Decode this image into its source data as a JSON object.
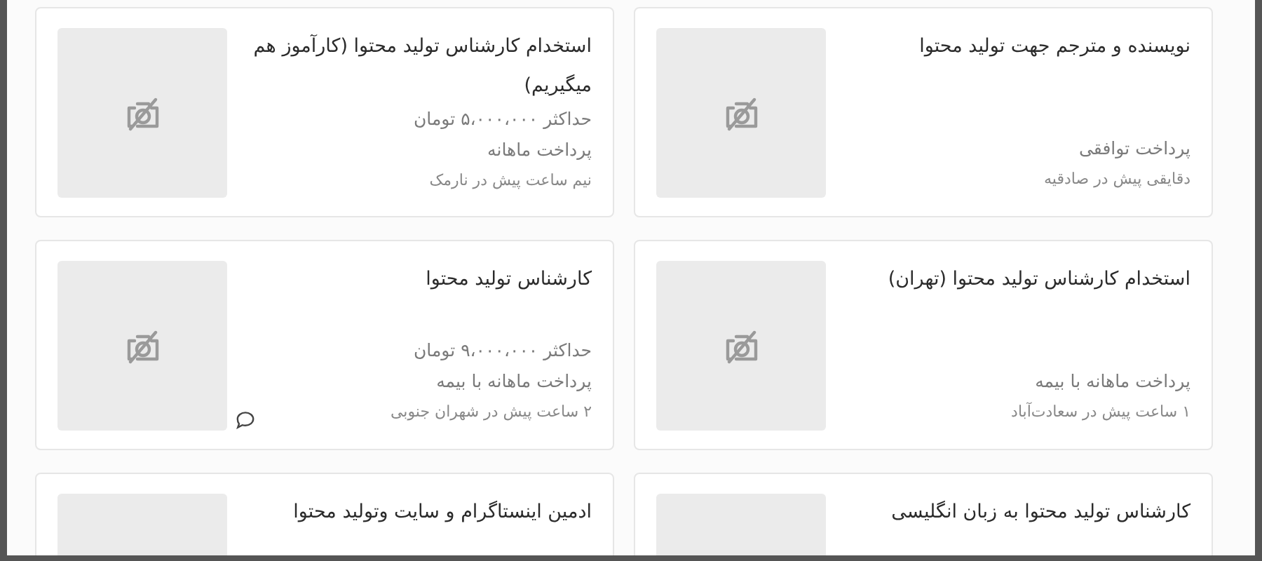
{
  "listings": [
    {
      "title": "نویسنده و مترجم جهت تولید محتوا",
      "payment": "پرداخت توافقی",
      "meta": "دقایقی پیش در صادقیه",
      "chat": false
    },
    {
      "title": "استخدام کارشناس تولید محتوا (کارآموز هم میگیریم)",
      "salary": "حداکثر ۵،۰۰۰،۰۰۰ تومان",
      "payment": "پرداخت ماهانه",
      "meta": "نیم ساعت پیش در نارمک",
      "chat": false
    },
    {
      "title": "استخدام کارشناس تولید محتوا (تهران)",
      "payment": "پرداخت ماهانه با بیمه",
      "meta": "۱ ساعت پیش در سعادت‌آباد",
      "chat": false
    },
    {
      "title": "کارشناس تولید محتوا",
      "salary": "حداکثر ۹،۰۰۰،۰۰۰ تومان",
      "payment": "پرداخت ماهانه با بیمه",
      "meta": "۲ ساعت پیش در شهران جنوبی",
      "chat": true
    },
    {
      "title": "کارشناس تولید محتوا به زبان انگلیسی",
      "chat": false
    },
    {
      "title": "ادمین اینستاگرام و سایت وتولید محتوا",
      "chat": false
    }
  ]
}
